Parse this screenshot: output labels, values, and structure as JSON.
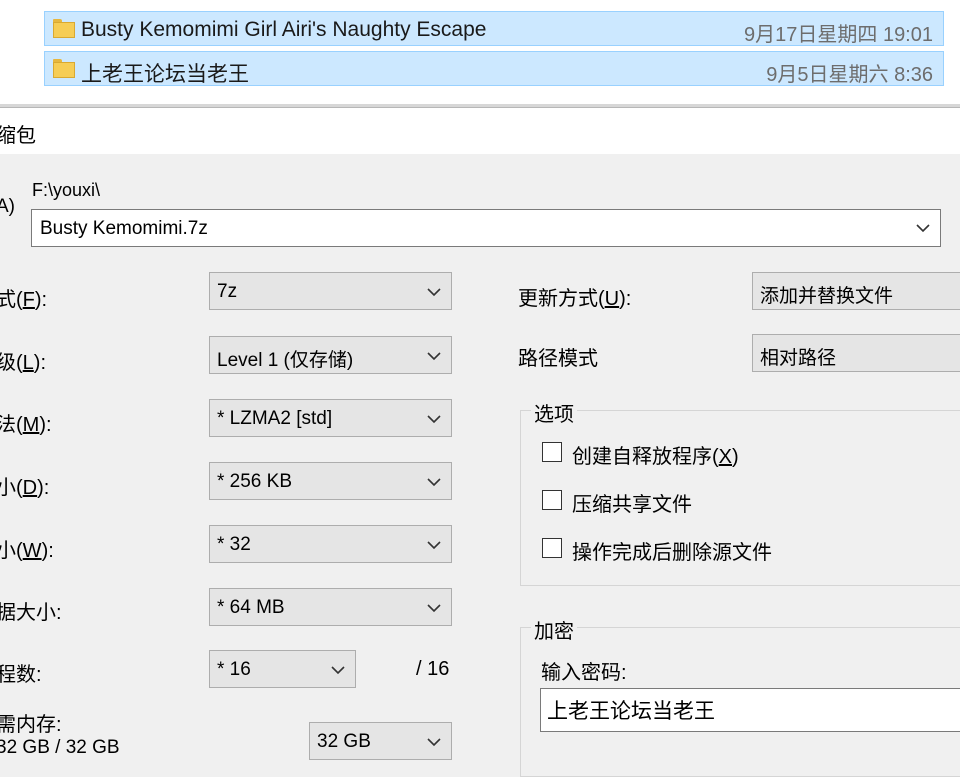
{
  "file_list": [
    {
      "name": "Busty Kemomimi Girl Airi's Naughty Escape",
      "date": "9月17日星期四 19:01",
      "icon": "folder-icon"
    },
    {
      "name": "上老王论坛当老王",
      "date": "9月5日星期六 8:36",
      "icon": "folder-icon"
    }
  ],
  "dialog": {
    "title": "缩包",
    "archive": {
      "label_fragment": "A)",
      "path": "F:\\youxi\\",
      "value": "Busty Kemomimi.7z"
    },
    "fields": [
      {
        "label": "式(",
        "key": "F",
        "close": "):",
        "value": "7z"
      },
      {
        "label": "级(",
        "key": "L",
        "close": "):",
        "value": "Level 1 (仅存储)"
      },
      {
        "label": "法(",
        "key": "M",
        "close": "):",
        "value": "*  LZMA2 [std]"
      },
      {
        "label": "小(",
        "key": "D",
        "close": "):",
        "value": "*  256 KB"
      },
      {
        "label": "小(",
        "key": "W",
        "close": "):",
        "value": "*  32"
      },
      {
        "label": "据大小:",
        "key": "",
        "close": "",
        "value": "*  64 MB"
      }
    ],
    "threads": {
      "label": "程数:",
      "value": "*  16",
      "max": "/ 16"
    },
    "memory": {
      "label": "需内存:",
      "usage": "32 GB / 32 GB",
      "value": "32 GB"
    },
    "update_mode": {
      "label": "更新方式(",
      "key": "U",
      "close": "):",
      "value": "添加并替换文件"
    },
    "path_mode": {
      "label": "路径模式",
      "value": "相对路径"
    },
    "options": {
      "title": "选项",
      "items": [
        {
          "label": "创建自释放程序(",
          "key": "X",
          "close": ")",
          "checked": false
        },
        {
          "label": "压缩共享文件",
          "key": "",
          "close": "",
          "checked": false
        },
        {
          "label": "操作完成后删除源文件",
          "key": "",
          "close": "",
          "checked": false
        }
      ]
    },
    "encryption": {
      "title": "加密",
      "password_label": "输入密码:",
      "password_value": "上老王论坛当老王"
    }
  },
  "colors": {
    "selection": "#cce8ff",
    "dialog_bg": "#f0f0f0",
    "combo_bg": "#e5e5e5",
    "folder": "#f6cd55"
  }
}
